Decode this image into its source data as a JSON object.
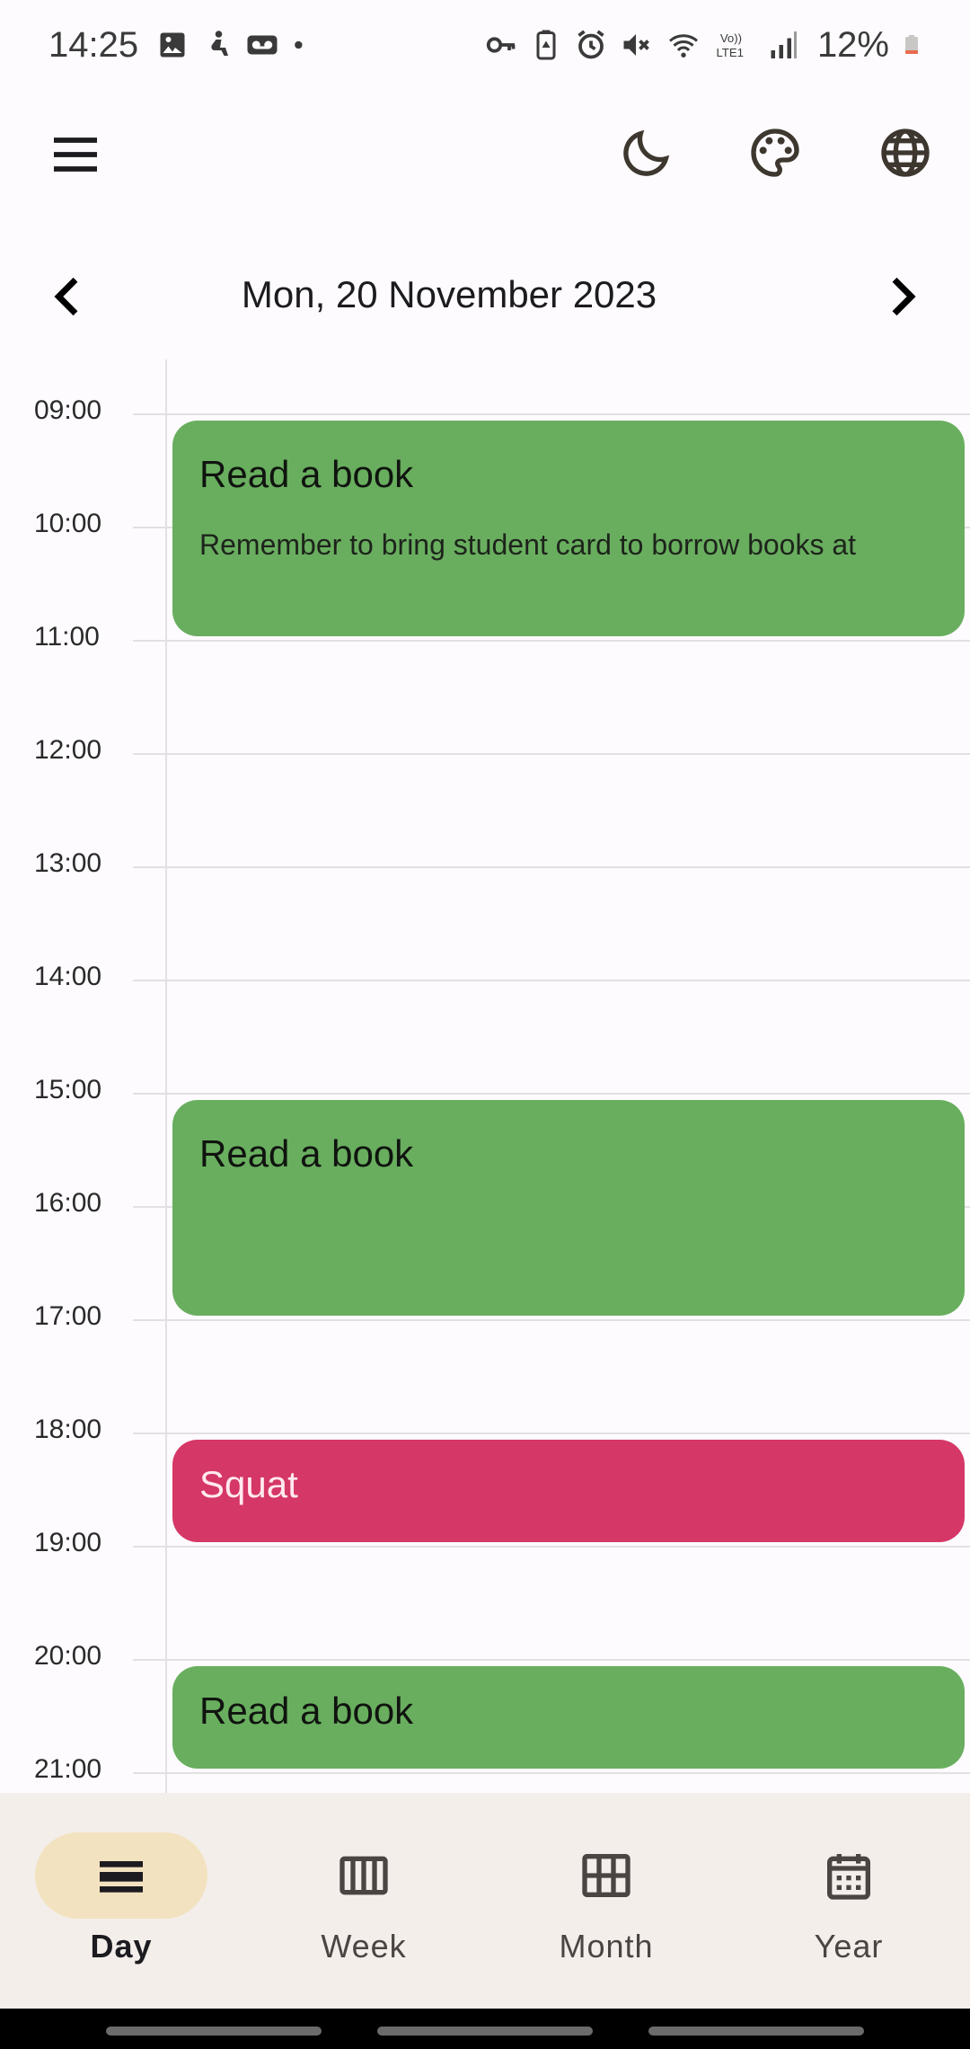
{
  "status_bar": {
    "time": "14:25",
    "battery": "12%",
    "icons_left": [
      "image-icon",
      "accessibility-icon",
      "voicemail-icon",
      "dot-icon"
    ],
    "icons_right": [
      "key-icon",
      "battery-saver-icon",
      "alarm-icon",
      "mute-icon",
      "wifi-icon",
      "volte-icon",
      "signal-icon",
      "battery-icon"
    ]
  },
  "app_bar": {
    "menu_icon": "menu-icon",
    "actions": [
      "dark-mode-icon",
      "palette-icon",
      "language-icon"
    ]
  },
  "date_header": {
    "title": "Mon, 20 November 2023",
    "prev_icon": "chevron-left-icon",
    "next_icon": "chevron-right-icon"
  },
  "timeline": {
    "hours": [
      "09:00",
      "10:00",
      "11:00",
      "12:00",
      "13:00",
      "14:00",
      "15:00",
      "16:00",
      "17:00",
      "18:00",
      "19:00",
      "20:00",
      "21:00"
    ],
    "events": [
      {
        "title": "Read a book",
        "description": "Remember to bring student card to borrow books at",
        "color": "#69ae5f",
        "start": "09:00",
        "end": "11:00"
      },
      {
        "title": "Read a book",
        "description": "",
        "color": "#69ae5f",
        "start": "15:00",
        "end": "17:00"
      },
      {
        "title": "Squat",
        "description": "",
        "color": "#d53766",
        "start": "18:00",
        "end": "19:00"
      },
      {
        "title": "Read a book",
        "description": "",
        "color": "#69ae5f",
        "start": "20:00",
        "end": "21:00"
      }
    ]
  },
  "bottom_nav": {
    "items": [
      {
        "label": "Day",
        "icon": "day-view-icon",
        "active": true
      },
      {
        "label": "Week",
        "icon": "week-view-icon",
        "active": false
      },
      {
        "label": "Month",
        "icon": "month-view-icon",
        "active": false
      },
      {
        "label": "Year",
        "icon": "calendar-icon",
        "active": false
      }
    ]
  },
  "colors": {
    "background": "#fdfbfe",
    "nav_background": "#f3eeea",
    "active_pill": "#f3e2bf",
    "event_green": "#69ae5f",
    "event_pink": "#d53766"
  }
}
